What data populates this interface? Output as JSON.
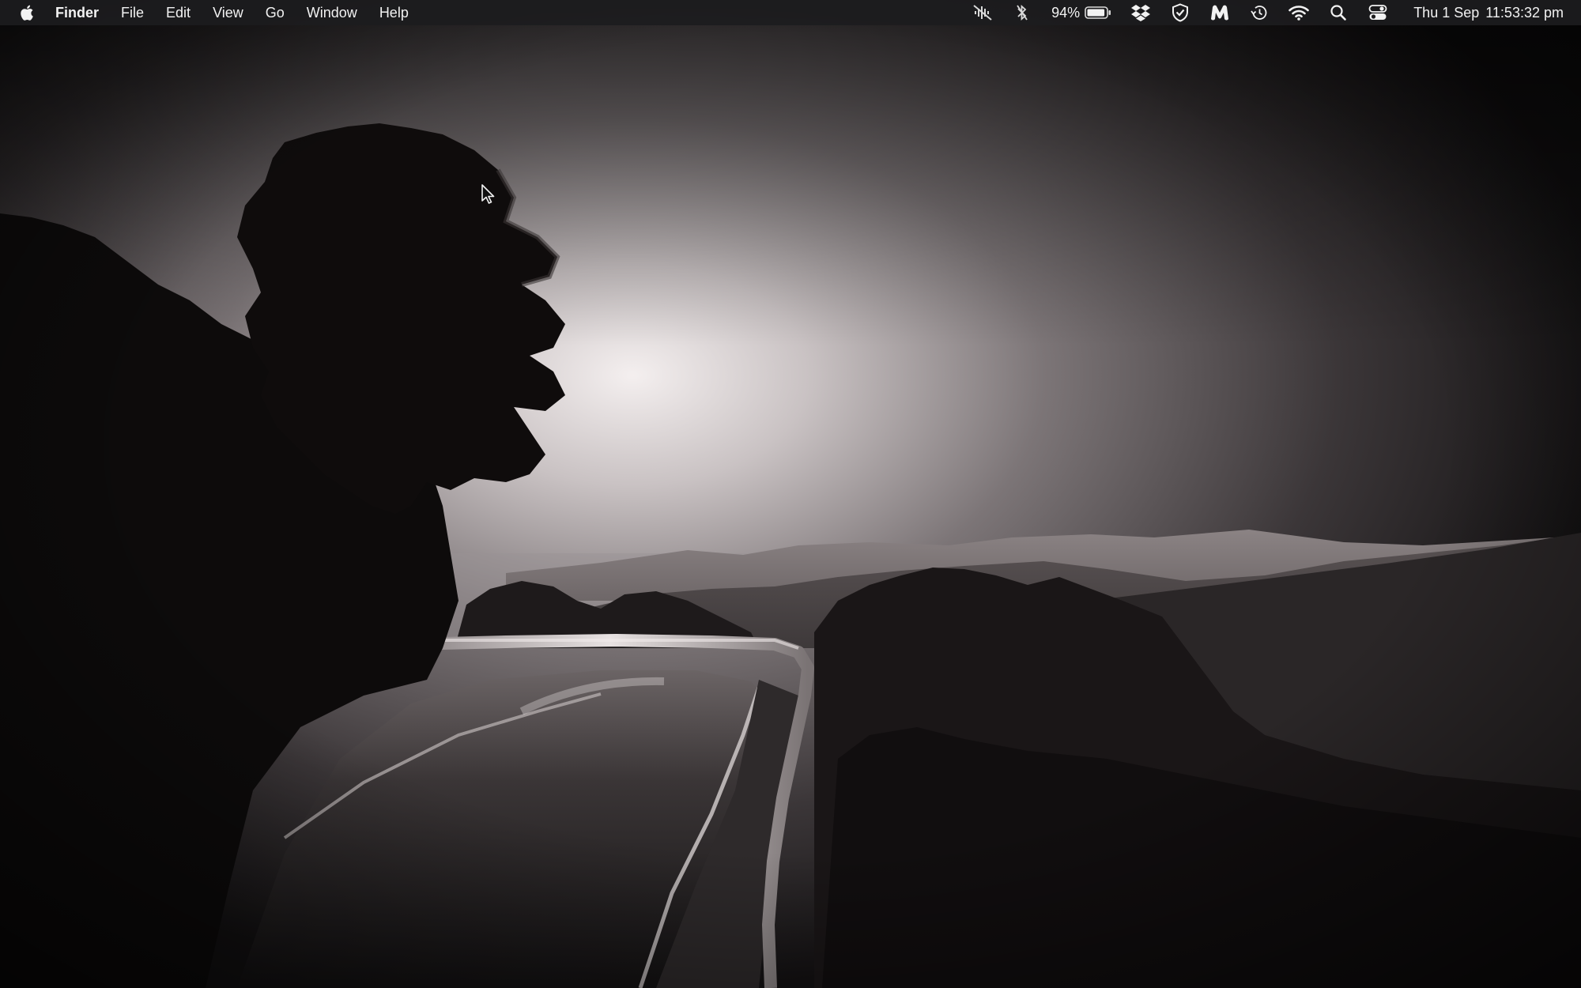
{
  "menubar": {
    "apple_icon": "apple-logo-icon",
    "app_name": "Finder",
    "menus": [
      "File",
      "Edit",
      "View",
      "Go",
      "Window",
      "Help"
    ],
    "status": {
      "icons": [
        "mic-muted-icon",
        "bluetooth-off-icon",
        "dropbox-icon",
        "shield-check-icon",
        "malwarebytes-icon",
        "time-machine-icon",
        "wifi-icon",
        "spotlight-search-icon",
        "control-center-icon"
      ],
      "battery_percent": "94%",
      "battery_level": 0.94,
      "date": "Thu 1 Sep",
      "time": "11:53:32 pm"
    }
  },
  "colors": {
    "menubar_bg": "#1c1c1e",
    "menubar_text": "#f2f2f2",
    "sky_glow": "#e9e3e3",
    "foliage": "#0d0b0b"
  }
}
